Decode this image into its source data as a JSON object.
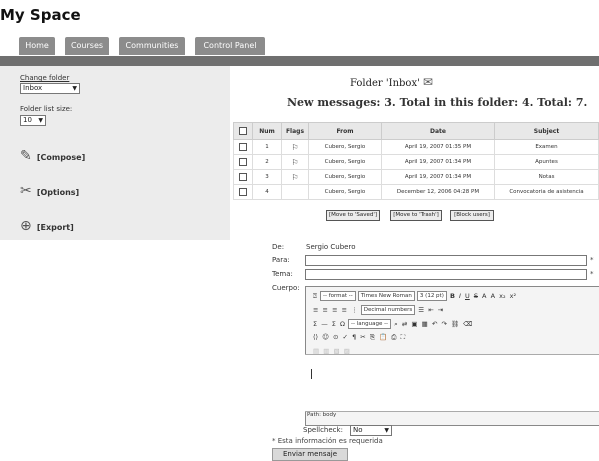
{
  "header": {
    "title": "My Space",
    "tabs": [
      "Home",
      "Courses",
      "Communities",
      "Control Panel"
    ]
  },
  "sidebar": {
    "change_folder_label": "Change folder",
    "folder_value": "Inbox",
    "list_size_label": "Folder list size:",
    "list_size_value": "10",
    "compose": "[Compose]",
    "options": "[Options]",
    "export": "[Export]"
  },
  "folder": {
    "title": "Folder 'Inbox'",
    "summary": "New messages: 3. Total in this folder: 4. Total: 7."
  },
  "table": {
    "headers": [
      "Num",
      "Flags",
      "From",
      "Date",
      "Subject"
    ],
    "rows": [
      {
        "num": "1",
        "flag": "⚐",
        "from": "Cubero, Sergio",
        "date": "April 19, 2007 01:35 PM",
        "subject": "Examen"
      },
      {
        "num": "2",
        "flag": "⚐",
        "from": "Cubero, Sergio",
        "date": "April 19, 2007 01:34 PM",
        "subject": "Apuntes"
      },
      {
        "num": "3",
        "flag": "⚐",
        "from": "Cubero, Sergio",
        "date": "April 19, 2007 01:34 PM",
        "subject": "Notas"
      },
      {
        "num": "4",
        "flag": "",
        "from": "Cubero, Sergio",
        "date": "December 12, 2006 04:28 PM",
        "subject": "Convocatoria de asistencia"
      }
    ],
    "buttons": [
      "[Move to 'Saved']",
      "[Move to 'Trash']",
      "[Block users]"
    ]
  },
  "compose": {
    "de_label": "De:",
    "de_value": "Sergio Cubero",
    "para_label": "Para:",
    "tema_label": "Tema:",
    "cuerpo_label": "Cuerpo:",
    "required_mark": "*",
    "toolbar": {
      "format": "-- format --",
      "font": "Times New Roman",
      "size": "3 (12 pt)",
      "list_style": "Decimal numbers",
      "language": "-- language --"
    },
    "path": "Path: body",
    "spellcheck_label": "Spellcheck:",
    "spellcheck_value": "No",
    "required_note": "Esta información es requerida",
    "send_button": "Enviar mensaje"
  }
}
